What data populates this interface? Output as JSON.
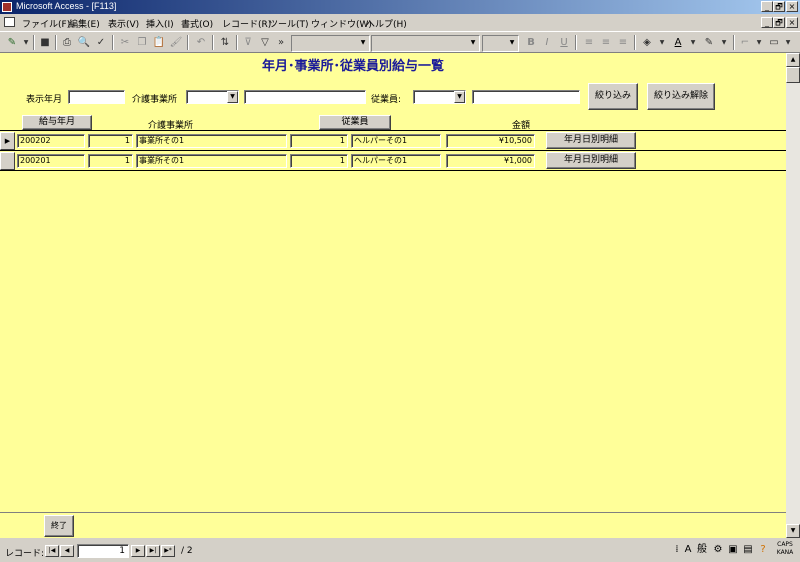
{
  "window": {
    "title": "Microsoft Access - [F113]",
    "minimize": "_",
    "restore": "🗗",
    "close": "×"
  },
  "menu": [
    "ファイル(F)",
    "編集(E)",
    "表示(V)",
    "挿入(I)",
    "書式(O)",
    "レコード(R)",
    "ツール(T)",
    "ウィンドウ(W)",
    "ヘルプ(H)"
  ],
  "toolbar": {
    "bold": "B",
    "italic": "I",
    "underline": "U"
  },
  "form": {
    "title": "年月･事業所･従業員別給与一覧",
    "filter": {
      "display_month_label": "表示年月",
      "display_month_value": "",
      "office_label": "介護事業所",
      "office_code": "",
      "office_name": "",
      "employee_label": "従業員:",
      "employee_code": "",
      "employee_name": "",
      "apply_button": "絞り込み",
      "clear_button": "絞り込み解除"
    },
    "headers": {
      "pay_month_button": "給与年月",
      "office": "介護事業所",
      "employee_button": "従業員",
      "amount": "金額"
    },
    "rows": [
      {
        "month": "200202",
        "office_no": "1",
        "office_name": "事業所その1",
        "employee_no": "1",
        "employee_name": "ヘルパーその1",
        "amount": "¥10,500",
        "detail_button": "年月日別明細"
      },
      {
        "month": "200201",
        "office_no": "1",
        "office_name": "事業所その1",
        "employee_no": "1",
        "employee_name": "ヘルパーその1",
        "amount": "¥1,000",
        "detail_button": "年月日別明細"
      }
    ],
    "exit_button": "終了"
  },
  "record_nav": {
    "label": "レコード:",
    "current": "1",
    "total": "/ 2"
  },
  "status": {
    "ime_mode": "般",
    "caps": "CAPS",
    "kana": "KANA"
  }
}
